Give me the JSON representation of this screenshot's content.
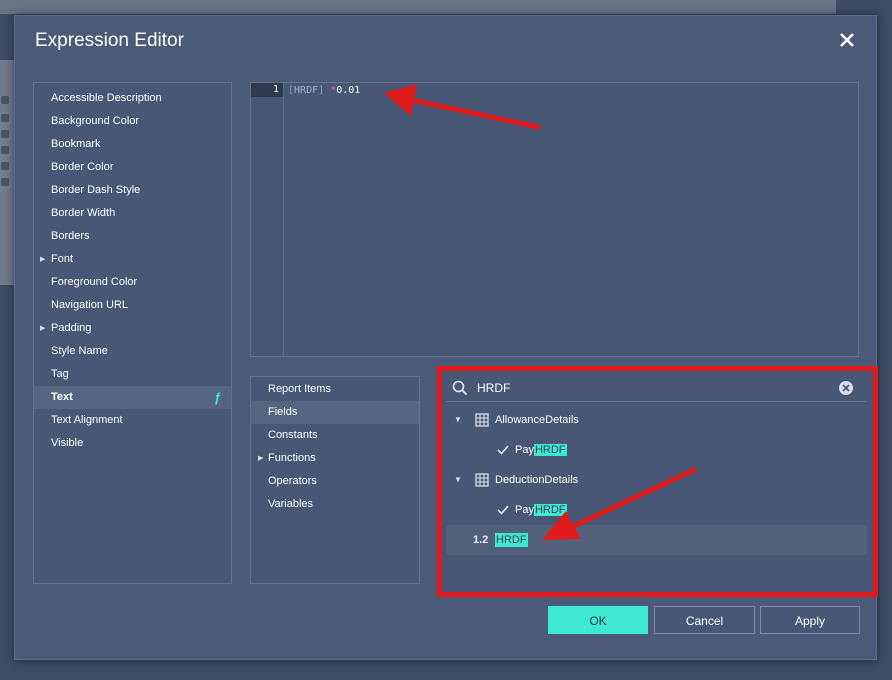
{
  "dialog": {
    "title": "Expression Editor"
  },
  "properties": [
    {
      "label": "Accessible Description"
    },
    {
      "label": "Background Color"
    },
    {
      "label": "Bookmark"
    },
    {
      "label": "Border Color"
    },
    {
      "label": "Border Dash Style"
    },
    {
      "label": "Border Width"
    },
    {
      "label": "Borders"
    },
    {
      "label": "Font",
      "expandable": true
    },
    {
      "label": "Foreground Color"
    },
    {
      "label": "Navigation URL"
    },
    {
      "label": "Padding",
      "expandable": true
    },
    {
      "label": "Style Name"
    },
    {
      "label": "Tag"
    },
    {
      "label": "Text",
      "selected": true,
      "has_expression": true
    },
    {
      "label": "Text Alignment"
    },
    {
      "label": "Visible"
    }
  ],
  "editor": {
    "line_number": "1",
    "code": {
      "open": "[",
      "field": "HRDF",
      "close": "]",
      "space": " ",
      "operator": "*",
      "number": "0.01"
    },
    "expression_icon": "ƒ"
  },
  "categories": [
    {
      "label": "Report Items"
    },
    {
      "label": "Fields",
      "selected": true
    },
    {
      "label": "Constants"
    },
    {
      "label": "Functions",
      "expandable": true
    },
    {
      "label": "Operators"
    },
    {
      "label": "Variables"
    }
  ],
  "search": {
    "value": "HRDF",
    "icon": "search-icon",
    "clear_icon": "clear-icon"
  },
  "tree": {
    "group1": {
      "label": "AllowanceDetails",
      "child_prefix": "Pay",
      "child_match": "HRDF"
    },
    "group2": {
      "label": "DeductionDetails",
      "child_prefix": "Pay",
      "child_match": "HRDF"
    },
    "param": {
      "type": "1.2",
      "match": "HRDF"
    }
  },
  "buttons": {
    "ok": "OK",
    "cancel": "Cancel",
    "apply": "Apply"
  },
  "colors": {
    "accent": "#3fe8d0",
    "annotation": "#e01b1b",
    "dialog_bg": "#4a5a78"
  }
}
